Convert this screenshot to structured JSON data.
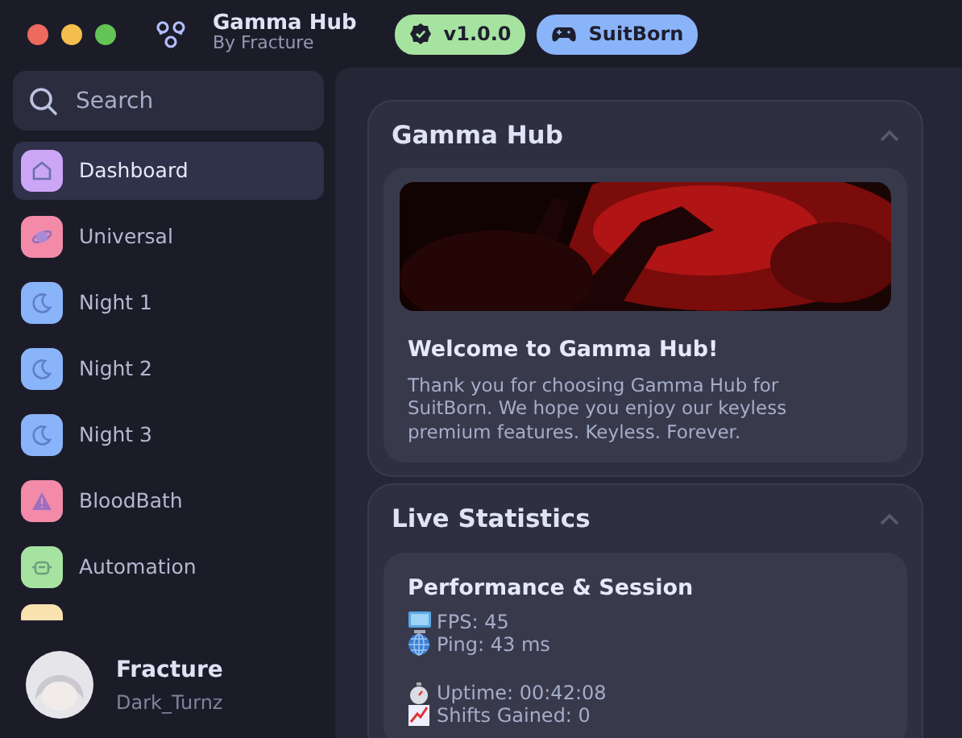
{
  "app": {
    "title": "Gamma Hub",
    "subtitle": "By Fracture"
  },
  "badges": [
    {
      "label": "v1.0.0",
      "kind": "version",
      "color": "#a6e3a1"
    },
    {
      "label": "SuitBorn",
      "kind": "game",
      "color": "#89b4fa"
    }
  ],
  "search": {
    "placeholder": "Search"
  },
  "sidebar": {
    "items": [
      {
        "label": "Dashboard",
        "color": "#cba6f7",
        "selected": true
      },
      {
        "label": "Universal",
        "color": "#f38ba8",
        "selected": false
      },
      {
        "label": "Night 1",
        "color": "#89b4fa",
        "selected": false
      },
      {
        "label": "Night 2",
        "color": "#89b4fa",
        "selected": false
      },
      {
        "label": "Night 3",
        "color": "#89b4fa",
        "selected": false
      },
      {
        "label": "BloodBath",
        "color": "#f38ba8",
        "selected": false
      },
      {
        "label": "Automation",
        "color": "#a6e3a1",
        "selected": false
      },
      {
        "color": "#f9e2af"
      }
    ]
  },
  "profile": {
    "name": "Fracture",
    "username": "Dark_Turnz"
  },
  "sections": [
    {
      "title": "Gamma Hub",
      "expanded": true,
      "kind": "welcome",
      "card": {
        "heading": "Welcome to Gamma Hub!",
        "text": "Thank you for choosing Gamma Hub for SuitBorn. We hope you enjoy our keyless premium features. Keyless. Forever."
      }
    },
    {
      "title": "Live Statistics",
      "expanded": true,
      "kind": "stats",
      "card": {
        "heading": "Performance & Session",
        "groups": [
          [
            "FPS: 45",
            "Ping: 43 ms"
          ],
          [
            "Uptime: 00:42:08",
            "Shifts Gained: 0"
          ]
        ]
      }
    }
  ]
}
